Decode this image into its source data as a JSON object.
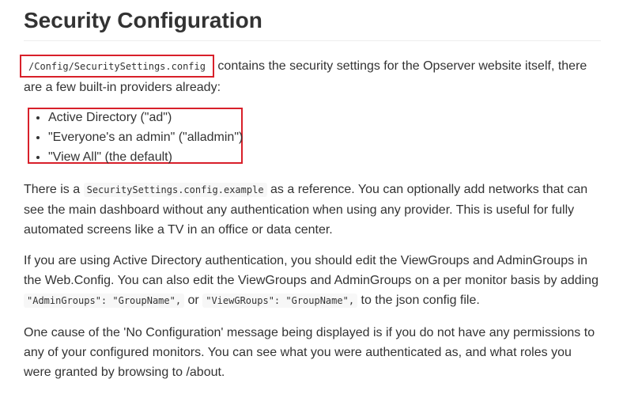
{
  "title": "Security Configuration",
  "intro": {
    "code": "/Config/SecuritySettings.config",
    "text": "contains the security settings for the Opserver website itself, there are a few built-in providers already:"
  },
  "providers": [
    "Active Directory (\"ad\")",
    "\"Everyone's an admin\" (\"alladmin\")",
    "\"View All\" (the default)"
  ],
  "reference": {
    "text_before": "There is a",
    "code": "SecuritySettings.config.example",
    "text_after": "as a reference. You can optionally add networks that can see the main dashboard without any authentication when using any provider. This is useful for fully automated screens like a TV in an office or data center."
  },
  "active_directory": {
    "text_before": "If you are using Active Directory authentication, you should edit the ViewGroups and AdminGroups in the Web.Config. You can also edit the ViewGroups and AdminGroups on a per monitor basis by adding",
    "code1": "\"AdminGroups\": \"GroupName\",",
    "text_or": "or",
    "code2": "\"ViewGRoups\": \"GroupName\",",
    "text_after": "to the json config file."
  },
  "no_config": {
    "text": "One cause of the 'No Configuration' message being displayed is if you do not have any permissions to any of your configured monitors. You can see what you were authenticated as, and what roles you were granted by browsing to /about."
  },
  "colors": {
    "highlight_border": "#d8202a",
    "text": "#333333",
    "code_background": "#f7f7f7"
  }
}
